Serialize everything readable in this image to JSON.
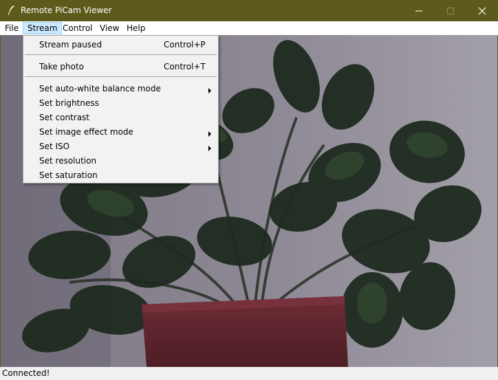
{
  "window": {
    "title": "Remote PiCam Viewer"
  },
  "menubar": {
    "file": "File",
    "stream": "Stream",
    "control": "Control",
    "view": "View",
    "help": "Help"
  },
  "stream_menu": {
    "stream_paused": {
      "label": "Stream paused",
      "shortcut": "Control+P"
    },
    "take_photo": {
      "label": "Take photo",
      "shortcut": "Control+T"
    },
    "set_awb": "Set auto-white balance mode",
    "set_brightness": "Set brightness",
    "set_contrast": "Set contrast",
    "set_image_effect": "Set image effect mode",
    "set_iso": "Set ISO",
    "set_resolution": "Set resolution",
    "set_saturation": "Set saturation"
  },
  "status": {
    "text": "Connected!"
  },
  "colors": {
    "titlebar": "#5d5b1c",
    "menu_highlight": "#cce8ff",
    "dropdown_bg": "#f2f2f2"
  }
}
